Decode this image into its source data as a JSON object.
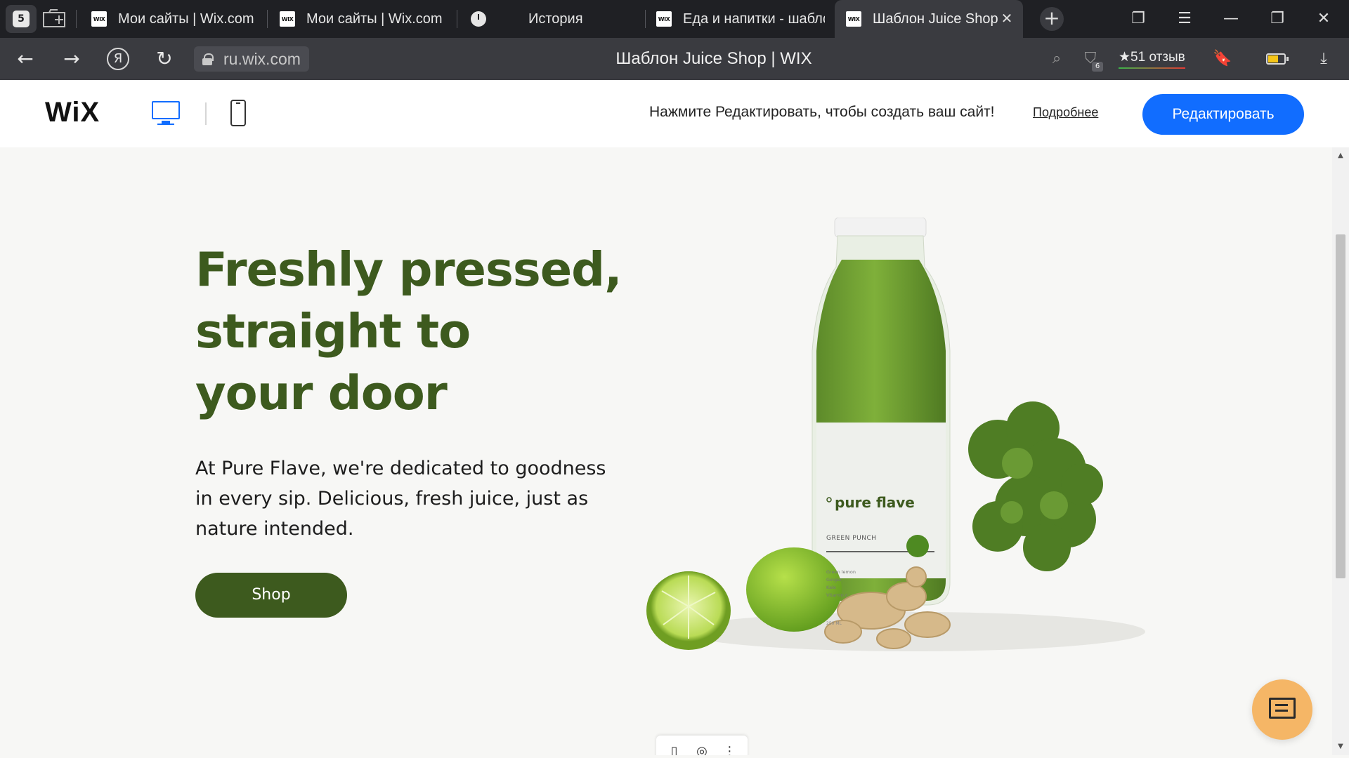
{
  "browser": {
    "tab_count": "5",
    "tabs": [
      {
        "label": "Мои сайты | Wix.com",
        "favicon": "WIX"
      },
      {
        "label": "Мои сайты | Wix.com",
        "favicon": "WIX"
      },
      {
        "label": "История",
        "favicon": "clock-icon"
      },
      {
        "label": "Еда и напитки - шаблс",
        "favicon": "WIX"
      },
      {
        "label": "Шаблон Juice Shop",
        "favicon": "WIX",
        "active": true
      }
    ],
    "url": "ru.wix.com",
    "page_title": "Шаблон Juice Shop | WIX",
    "extensions_badge": "6",
    "reviews_label": "★51 отзыв"
  },
  "wix_bar": {
    "logo": "WiX",
    "message": "Нажмите Редактировать, чтобы создать ваш сайт!",
    "learn_more": "Подробнее",
    "edit_button": "Редактировать"
  },
  "hero": {
    "title_lines": [
      "Freshly pressed,",
      "straight to",
      "your door"
    ],
    "description": "At Pure Flave, we're dedicated to goodness in every sip. Delicious, fresh juice, just as nature intended.",
    "shop_button": "Shop",
    "bottle_label": {
      "brand": "pure flave",
      "flavor": "GREEN PUNCH",
      "ingredients": [
        "Green lemon",
        "Ginger",
        "Kale",
        "Vitamin c"
      ],
      "volume": "250 ML"
    }
  },
  "colors": {
    "brand_green": "#3d5a1e",
    "wix_blue": "#116dff",
    "chat_orange": "#f5b666",
    "page_bg": "#f7f7f5"
  }
}
